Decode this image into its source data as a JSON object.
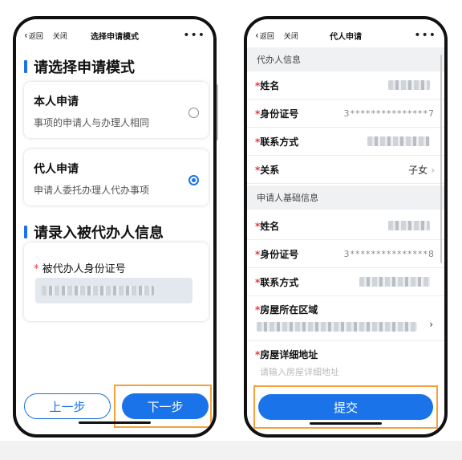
{
  "left_screen": {
    "nav": {
      "back": "返回",
      "close": "关闭",
      "title": "选择申请模式",
      "more": "•••"
    },
    "mode_heading": "请选择申请模式",
    "options": [
      {
        "title": "本人申请",
        "desc": "事项的申请人与办理人相同",
        "selected": false
      },
      {
        "title": "代人申请",
        "desc": "申请人委托办理人代办事项",
        "selected": true
      }
    ],
    "info_heading": "请录入被代办人信息",
    "id_field": {
      "required_mark": "*",
      "label": "被代办人身份证号"
    },
    "buttons": {
      "prev": "上一步",
      "next": "下一步"
    }
  },
  "right_screen": {
    "nav": {
      "back": "返回",
      "close": "关闭",
      "title": "代人申请",
      "more": "•••"
    },
    "agent_section": "代办人信息",
    "agent_fields": [
      {
        "label": "姓名",
        "value": ""
      },
      {
        "label": "身份证号",
        "value": "3***************7"
      },
      {
        "label": "联系方式",
        "value": ""
      },
      {
        "label": "关系",
        "value": "子女"
      }
    ],
    "applicant_section": "申请人基础信息",
    "applicant_fields": [
      {
        "label": "姓名",
        "value": ""
      },
      {
        "label": "身份证号",
        "value": "3***************8"
      },
      {
        "label": "联系方式",
        "value": ""
      },
      {
        "label": "房屋所在区域",
        "value": ""
      },
      {
        "label": "房屋详细地址",
        "placeholder": "请输入房屋详细地址"
      }
    ],
    "required_mark": "*",
    "submit": "提交"
  },
  "colors": {
    "accent": "#1a73e8",
    "highlight": "#f5a03c",
    "required": "#e53935"
  }
}
